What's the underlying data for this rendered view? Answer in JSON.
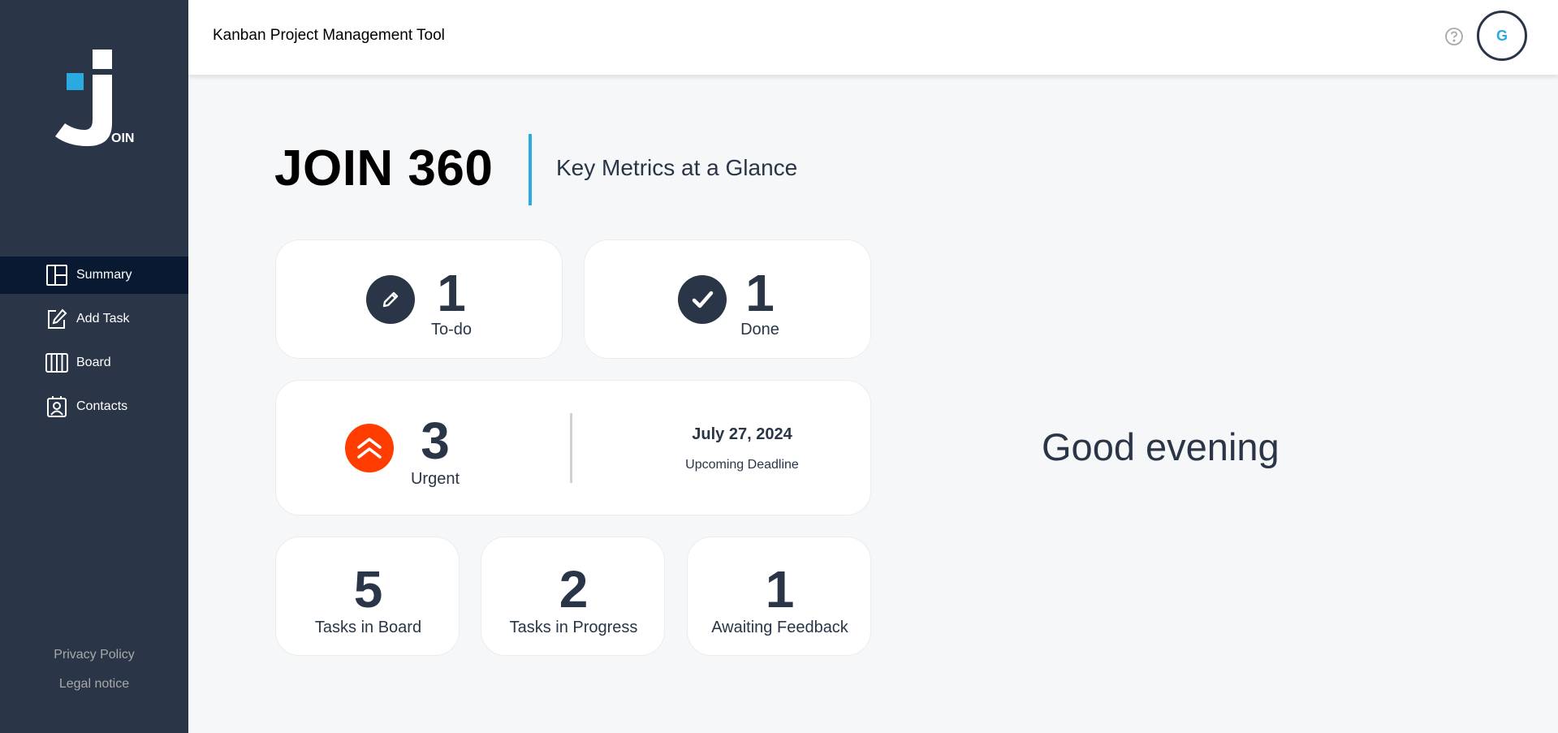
{
  "app": {
    "title": "Kanban Project Management Tool",
    "logo_text": "OIN"
  },
  "user": {
    "initial": "G"
  },
  "sidebar": {
    "items": [
      {
        "label": "Summary",
        "icon": "summary-icon",
        "active": true
      },
      {
        "label": "Add Task",
        "icon": "add-task-icon",
        "active": false
      },
      {
        "label": "Board",
        "icon": "board-icon",
        "active": false
      },
      {
        "label": "Contacts",
        "icon": "contacts-icon",
        "active": false
      }
    ],
    "footer": {
      "privacy": "Privacy Policy",
      "legal": "Legal notice"
    }
  },
  "summary": {
    "title": "JOIN 360",
    "subtitle": "Key Metrics at a Glance",
    "todo": {
      "count": "1",
      "label": "To-do"
    },
    "done": {
      "count": "1",
      "label": "Done"
    },
    "urgent": {
      "count": "3",
      "label": "Urgent"
    },
    "deadline": {
      "date": "July 27, 2024",
      "label": "Upcoming Deadline"
    },
    "board": {
      "count": "5",
      "label": "Tasks in Board"
    },
    "progress": {
      "count": "2",
      "label": "Tasks in Progress"
    },
    "feedback": {
      "count": "1",
      "label": "Awaiting Feedback"
    },
    "greeting": "Good evening"
  },
  "colors": {
    "sidebar": "#2a3647",
    "active_nav": "#091931",
    "accent": "#29abe2",
    "urgent": "#ff3d00",
    "background": "#f6f7f8"
  }
}
